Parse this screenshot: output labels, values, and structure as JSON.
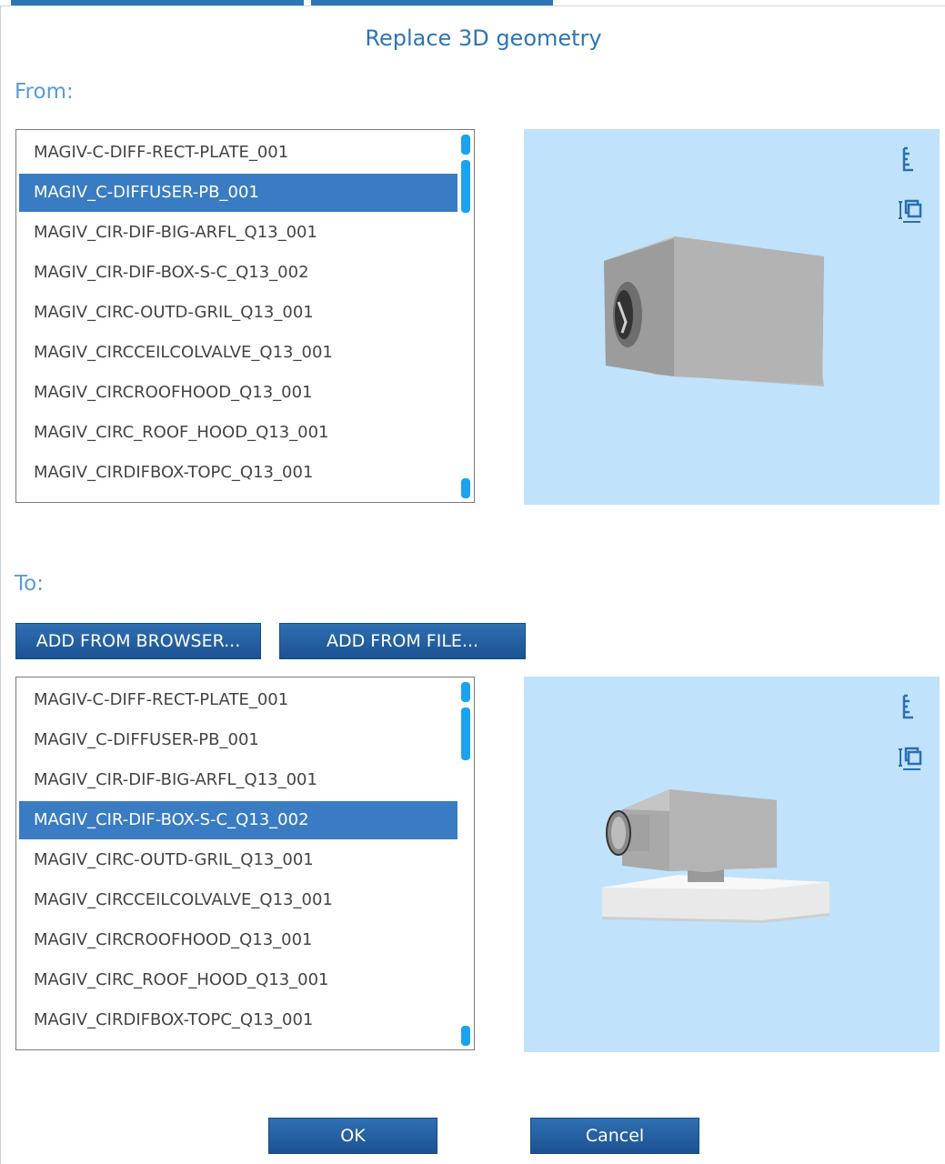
{
  "dialog": {
    "title": "Replace 3D geometry",
    "from_label": "From:",
    "to_label": "To:",
    "ok_label": "OK",
    "cancel_label": "Cancel"
  },
  "from_list": {
    "selected_index": 1,
    "items": [
      "MAGIV-C-DIFF-RECT-PLATE_001",
      "MAGIV_C-DIFFUSER-PB_001",
      "MAGIV_CIR-DIF-BIG-ARFL_Q13_001",
      "MAGIV_CIR-DIF-BOX-S-C_Q13_002",
      "MAGIV_CIRC-OUTD-GRIL_Q13_001",
      "MAGIV_CIRCCEILCOLVALVE_Q13_001",
      "MAGIV_CIRCROOFHOOD_Q13_001",
      "MAGIV_CIRC_ROOF_HOOD_Q13_001",
      "MAGIV_CIRDIFBOX-TOPC_Q13_001"
    ]
  },
  "to_toolbar": {
    "add_from_browser_label": "ADD FROM BROWSER...",
    "add_from_file_label": "ADD FROM FILE..."
  },
  "to_list": {
    "selected_index": 3,
    "items": [
      "MAGIV-C-DIFF-RECT-PLATE_001",
      "MAGIV_C-DIFFUSER-PB_001",
      "MAGIV_CIR-DIF-BIG-ARFL_Q13_001",
      "MAGIV_CIR-DIF-BOX-S-C_Q13_002",
      "MAGIV_CIRC-OUTD-GRIL_Q13_001",
      "MAGIV_CIRCCEILCOLVALVE_Q13_001",
      "MAGIV_CIRCROOFHOOD_Q13_001",
      "MAGIV_CIRC_ROOF_HOOD_Q13_001",
      "MAGIV_CIRDIFBOX-TOPC_Q13_001"
    ]
  },
  "preview": {
    "icons": [
      "ruler-icon",
      "frame-icon"
    ]
  },
  "colors": {
    "accent": "#2e75b6",
    "label": "#5b9bd5",
    "selection": "#3a7cc3",
    "preview_bg": "#c1e2fb",
    "scrollbar": "#1aa3ee"
  }
}
